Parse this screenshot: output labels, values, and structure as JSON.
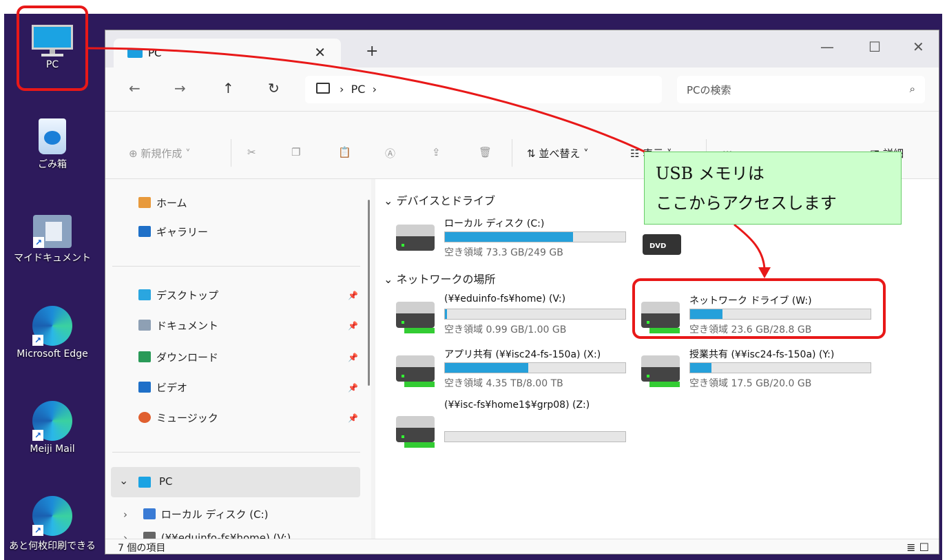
{
  "desktop": {
    "icons": [
      {
        "label": "PC"
      },
      {
        "label": "ごみ箱"
      },
      {
        "label": "マイドキュメント"
      },
      {
        "label": "Microsoft Edge"
      },
      {
        "label": "Meiji Mail"
      },
      {
        "label": "あと何枚印刷できる"
      }
    ]
  },
  "window": {
    "tab_label": "PC",
    "tab_close": "✕",
    "tab_add": "+",
    "controls": {
      "minimize": "—",
      "maximize": "☐",
      "close": "✕"
    },
    "nav": {
      "back": "←",
      "forward": "→",
      "up": "↑",
      "refresh": "↻"
    },
    "address": "›  PC  ›",
    "search_placeholder": "PCの検索",
    "search_icon": "⌕",
    "toolbar": {
      "new": "⊕  新規作成 ˅",
      "cut": "✂",
      "copy": "❐",
      "paste": "📋",
      "rename": "Ⓐ",
      "share": "⇪",
      "delete": "🗑",
      "sort": "⇅  並べ替え ˅",
      "view": "☷  表示 ˅",
      "more": "···",
      "details": "◨  詳細"
    },
    "navpane": {
      "home": "ホーム",
      "gallery": "ギャラリー",
      "desktop": "デスクトップ",
      "documents": "ドキュメント",
      "downloads": "ダウンロード",
      "videos": "ビデオ",
      "music": "ミュージック",
      "pin": "📌",
      "pc": "PC",
      "pc_chevron": "⌄",
      "local_disk": "ローカル ディスク (C:)",
      "local_chevron": "›",
      "home_share": "(¥¥eduinfo-fs¥home) (V:)",
      "home_chevron": "›"
    },
    "content": {
      "group_devices": "⌄ デバイスとドライブ",
      "group_network": "⌄ ネットワークの場所",
      "dvd_label": "DVD",
      "drives": [
        {
          "name": "ローカル ディスク (C:)",
          "free": "空き領域 73.3 GB/249 GB",
          "used_fraction": 0.71
        },
        {
          "name": "(¥¥eduinfo-fs¥home) (V:)",
          "free": "空き領域 0.99 GB/1.00 GB",
          "used_fraction": 0.01
        },
        {
          "name": "ネットワーク ドライブ (W:)",
          "free": "空き領域 23.6 GB/28.8 GB",
          "used_fraction": 0.18
        },
        {
          "name": "アプリ共有 (¥¥isc24-fs-150a) (X:)",
          "free": "空き領域 4.35 TB/8.00 TB",
          "used_fraction": 0.46
        },
        {
          "name": "授業共有 (¥¥isc24-fs-150a) (Y:)",
          "free": "空き領域 17.5 GB/20.0 GB",
          "used_fraction": 0.12
        },
        {
          "name": "(¥¥isc-fs¥home1$¥grp08) (Z:)",
          "free": "",
          "used_fraction": 0.0
        }
      ]
    },
    "status": "7 個の項目",
    "status_icons": "≣ ☐"
  },
  "annotation": {
    "callout_line1": "USB メモリは",
    "callout_line2": "ここからアクセスします"
  }
}
